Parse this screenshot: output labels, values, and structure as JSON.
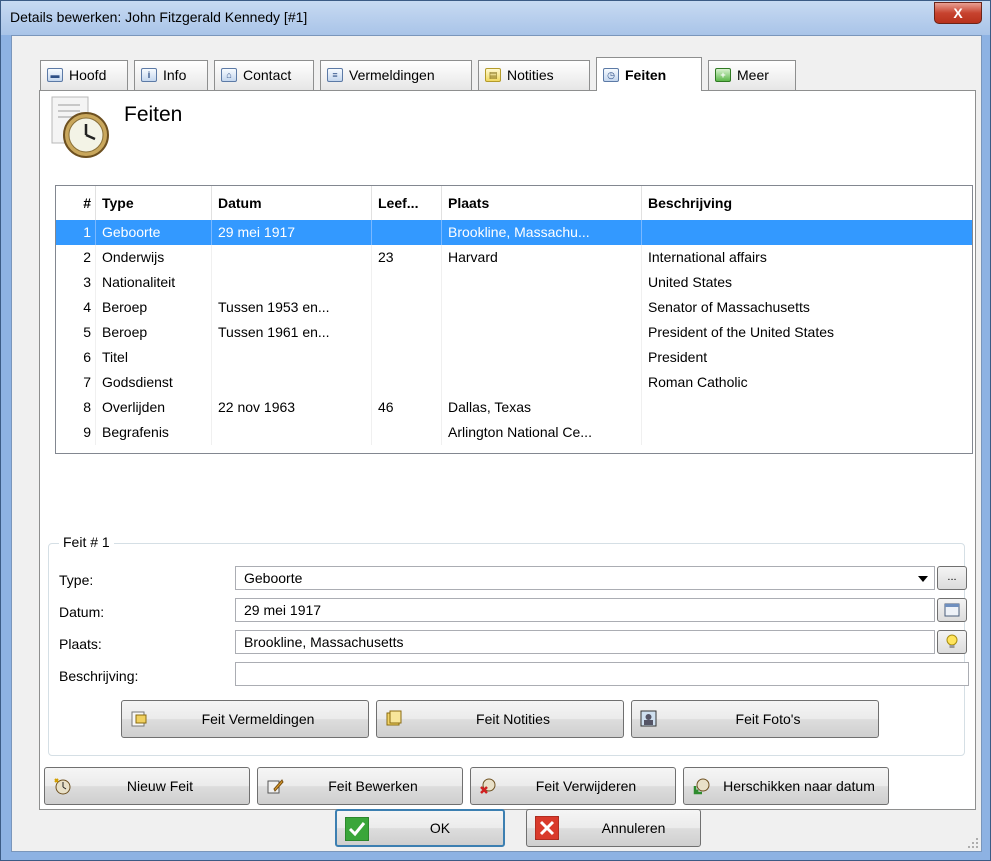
{
  "window": {
    "title": "Details bewerken: John Fitzgerald Kennedy [#1]",
    "close_glyph": "X"
  },
  "tabs": [
    {
      "label": "Hoofd",
      "icon": "card-icon",
      "active": false
    },
    {
      "label": "Info",
      "icon": "info-icon",
      "active": false
    },
    {
      "label": "Contact",
      "icon": "house-icon",
      "active": false
    },
    {
      "label": "Vermeldingen",
      "icon": "citation-icon",
      "active": false
    },
    {
      "label": "Notities",
      "icon": "note-icon",
      "active": false
    },
    {
      "label": "Feiten",
      "icon": "clock-icon",
      "active": true
    },
    {
      "label": "Meer",
      "icon": "plus-icon",
      "active": false
    }
  ],
  "panel": {
    "title": "Feiten"
  },
  "grid": {
    "columns": [
      "#",
      "Type",
      "Datum",
      "Leef...",
      "Plaats",
      "Beschrijving"
    ],
    "rows": [
      [
        "1",
        "Geboorte",
        "29 mei 1917",
        "",
        "Brookline, Massachu...",
        ""
      ],
      [
        "2",
        "Onderwijs",
        "",
        "23",
        "Harvard",
        "International affairs"
      ],
      [
        "3",
        "Nationaliteit",
        "",
        "",
        "",
        "United States"
      ],
      [
        "4",
        "Beroep",
        "Tussen 1953 en...",
        "",
        "",
        "Senator of Massachusetts"
      ],
      [
        "5",
        "Beroep",
        "Tussen 1961 en...",
        "",
        "",
        "President of the United States"
      ],
      [
        "6",
        "Titel",
        "",
        "",
        "",
        "President"
      ],
      [
        "7",
        "Godsdienst",
        "",
        "",
        "",
        "Roman Catholic"
      ],
      [
        "8",
        "Overlijden",
        "22 nov 1963",
        "46",
        "Dallas, Texas",
        ""
      ],
      [
        "9",
        "Begrafenis",
        "",
        "",
        "Arlington National Ce...",
        ""
      ]
    ],
    "selected_row": 0
  },
  "feit": {
    "legend": "Feit # 1",
    "type_label": "Type:",
    "type_value": "Geboorte",
    "datum_label": "Datum:",
    "datum_value": "29 mei 1917",
    "plaats_label": "Plaats:",
    "plaats_value": "Brookline, Massachusetts",
    "beschrijving_label": "Beschrijving:",
    "beschrijving_value": "",
    "ellipsis": "...",
    "btn_vermeldingen": "Feit Vermeldingen",
    "btn_notities": "Feit Notities",
    "btn_fotos": "Feit Foto's"
  },
  "actions": {
    "nieuw": "Nieuw Feit",
    "bewerken": "Feit Bewerken",
    "verwijderen": "Feit Verwijderen",
    "herschikken": "Herschikken naar datum"
  },
  "footer": {
    "ok": "OK",
    "cancel": "Annuleren"
  },
  "colors": {
    "selection": "#3399ff",
    "ok_green": "#3aa63a",
    "cancel_red": "#d93a2b"
  }
}
